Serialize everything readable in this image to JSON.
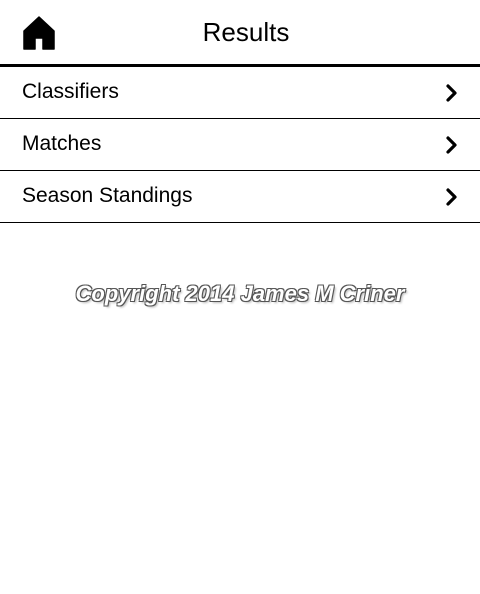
{
  "header": {
    "title": "Results",
    "home_icon": "home-icon"
  },
  "menu": {
    "items": [
      {
        "label": "Classifiers",
        "icon": "chevron-right-icon"
      },
      {
        "label": "Matches",
        "icon": "chevron-right-icon"
      },
      {
        "label": "Season Standings",
        "icon": "chevron-right-icon"
      }
    ]
  },
  "footer": {
    "copyright": "Copyright 2014 James M Criner"
  }
}
